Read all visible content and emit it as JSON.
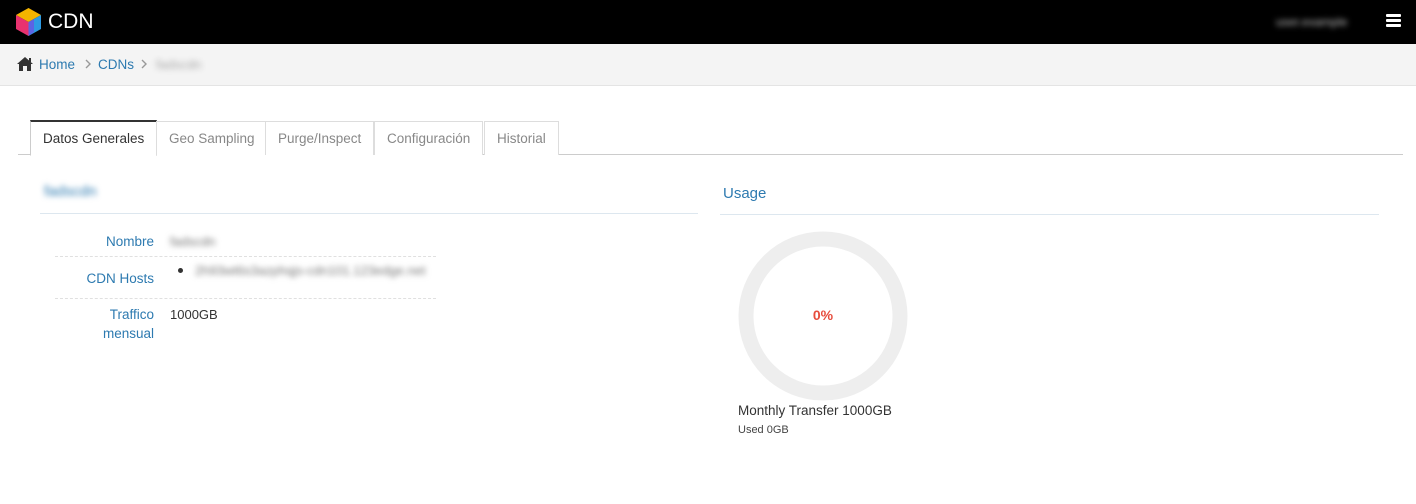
{
  "header": {
    "app_title": "CDN",
    "user_name": "user.example",
    "icons": {
      "logo": "cube-logo-icon",
      "menu": "hamburger-menu-icon"
    }
  },
  "breadcrumb": {
    "home": "Home",
    "section": "CDNs",
    "current": "fadscdn",
    "icons": {
      "home": "home-icon",
      "separator": "chevron-right-icon"
    }
  },
  "tabs": [
    "Datos Generales",
    "Geo Sampling",
    "Purge/Inspect",
    "Configuración",
    "Historial"
  ],
  "active_tab": "Datos Generales",
  "details": {
    "title": "fadscdn",
    "rows": [
      {
        "label": "Nombre",
        "value": "fadscdn"
      },
      {
        "label": "CDN Hosts",
        "value": "2h93wt6s3azphqjs-cdn101.123edge.net"
      },
      {
        "label": "Traffico mensual",
        "value": "1000GB"
      }
    ]
  },
  "usage": {
    "title": "Usage",
    "percent_label": "0%",
    "percent_value": 0,
    "monthly_transfer": "Monthly Transfer 1000GB",
    "used": "Used 0GB"
  },
  "colors": {
    "topbar": "#000000",
    "link": "#2d7ab0",
    "percent": "#e74c3c",
    "gauge_track": "#eeeeee"
  }
}
